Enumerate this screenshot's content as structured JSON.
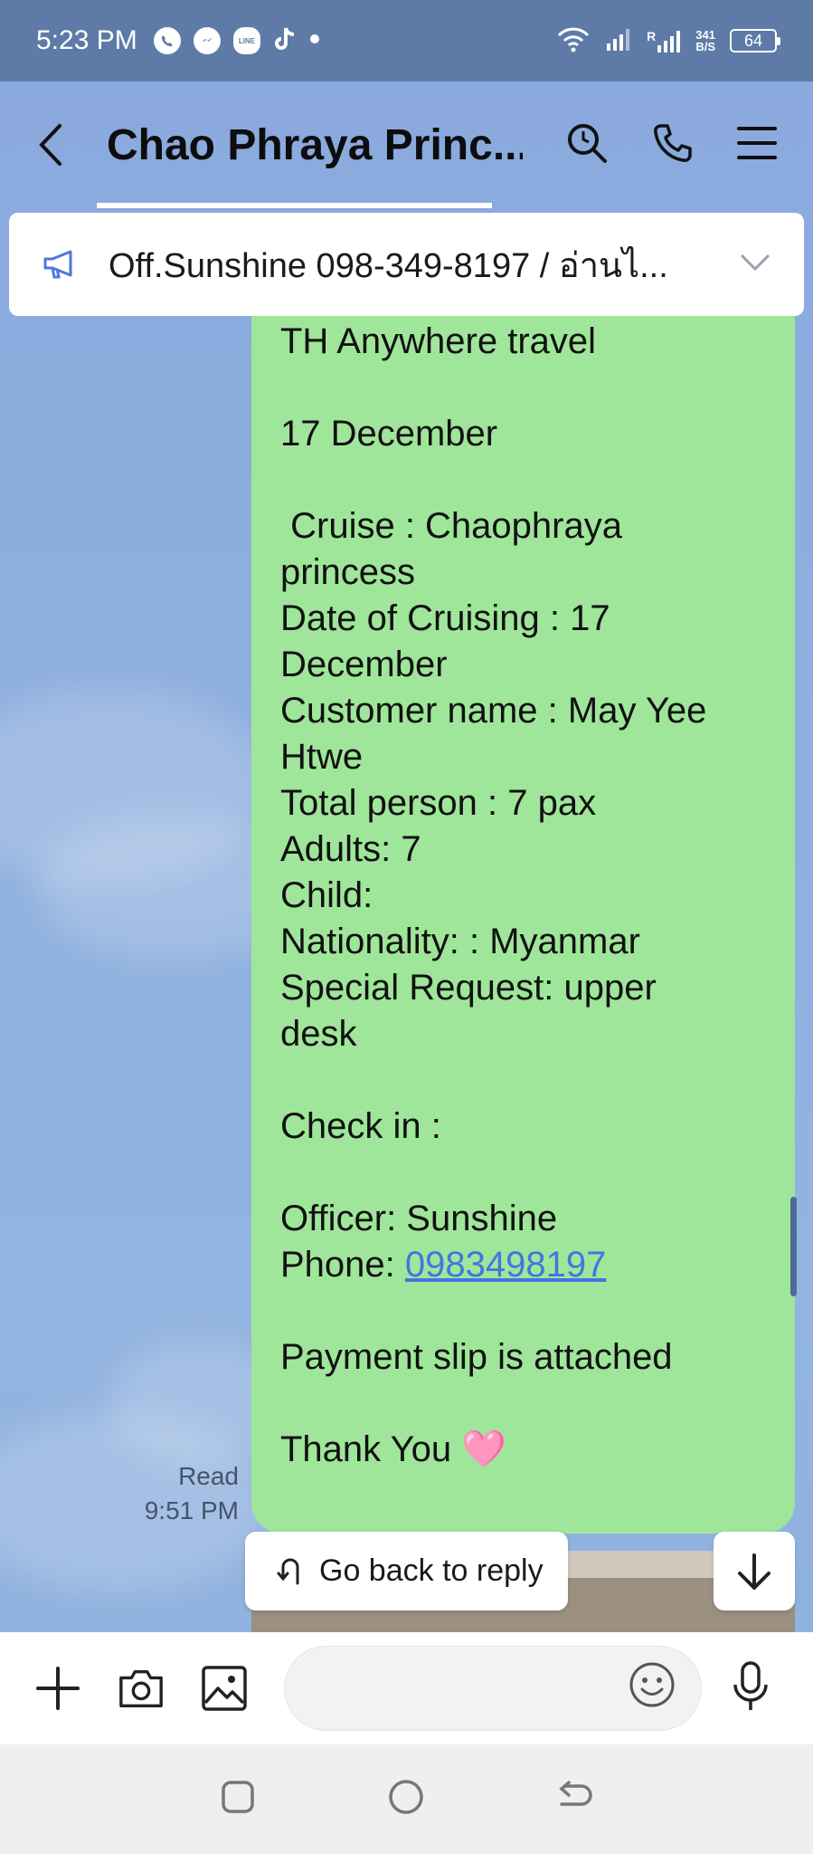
{
  "status_bar": {
    "time": "5:23 PM",
    "speed_value": "341",
    "speed_unit": "B/S",
    "battery": "64",
    "signal_r": "R"
  },
  "header": {
    "title": "Chao Phraya Princ..."
  },
  "announcement": {
    "text": "Off.Sunshine  098-349-8197 / อ่านไ..."
  },
  "message": {
    "lines": [
      "TH Anywhere travel",
      "",
      "17 December",
      "",
      " Cruise : Chaophraya",
      "princess",
      "Date of Cruising : 17",
      "December",
      "Customer name : May Yee",
      "Htwe",
      "Total person : 7 pax",
      "Adults: 7",
      "Child:",
      "Nationality: : Myanmar",
      "Special Request: upper",
      "desk",
      "",
      "Check in :",
      "",
      "Officer: Sunshine"
    ],
    "phone_label": "Phone: ",
    "phone_link": "0983498197",
    "lines_after": [
      "",
      "Payment slip is attached",
      "",
      "Thank You"
    ],
    "heart": "🩷",
    "read_status": "Read",
    "time": "9:51 PM"
  },
  "controls": {
    "go_back_label": "Go back to reply"
  },
  "input": {
    "placeholder": ""
  },
  "colors": {
    "bubble": "#9fe69a",
    "link": "#3f78e0",
    "status_bar": "#5d7ba6",
    "background": "#8eabdc"
  },
  "icons": {
    "header": [
      "back-arrow-icon",
      "search-icon",
      "phone-icon",
      "menu-icon"
    ],
    "input": [
      "plus-icon",
      "camera-icon",
      "image-icon",
      "emoji-icon",
      "mic-icon"
    ],
    "nav": [
      "recent-apps-icon",
      "home-icon",
      "back-icon"
    ]
  }
}
